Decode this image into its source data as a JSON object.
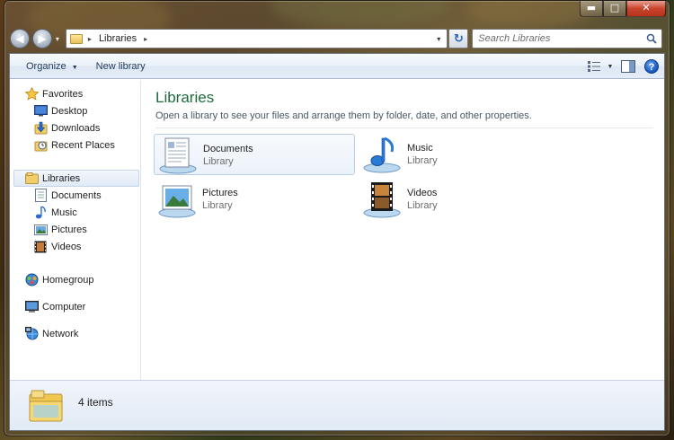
{
  "window": {
    "caption": {
      "minimize": "▬",
      "maximize": "□",
      "close": "✕"
    }
  },
  "navigation": {
    "back_arrow": "◀",
    "forward_arrow": "▶",
    "history_caret": "▾",
    "address": {
      "segments": [
        "Libraries"
      ],
      "separator": "▸",
      "dropdown": "▾"
    },
    "refresh_glyph": "↻",
    "search": {
      "placeholder": "Search Libraries"
    }
  },
  "toolbar": {
    "organize_label": "Organize",
    "organize_caret": "▼",
    "new_library_label": "New library",
    "view_caret": "▼",
    "help_label": "?"
  },
  "sidebar": {
    "favorites": {
      "header": "Favorites",
      "items": [
        {
          "label": "Desktop",
          "icon": "desktop-icon"
        },
        {
          "label": "Downloads",
          "icon": "downloads-icon"
        },
        {
          "label": "Recent Places",
          "icon": "recent-places-icon"
        }
      ]
    },
    "libraries": {
      "header": "Libraries",
      "items": [
        {
          "label": "Documents",
          "icon": "documents-icon"
        },
        {
          "label": "Music",
          "icon": "music-icon"
        },
        {
          "label": "Pictures",
          "icon": "pictures-icon"
        },
        {
          "label": "Videos",
          "icon": "videos-icon"
        }
      ]
    },
    "homegroup": "Homegroup",
    "computer": "Computer",
    "network": "Network"
  },
  "main": {
    "title": "Libraries",
    "subtitle": "Open a library to see your files and arrange them by folder, date, and other properties.",
    "libraries": [
      {
        "name": "Documents",
        "type": "Library",
        "icon": "documents-library-icon",
        "selected": true
      },
      {
        "name": "Music",
        "type": "Library",
        "icon": "music-library-icon",
        "selected": false
      },
      {
        "name": "Pictures",
        "type": "Library",
        "icon": "pictures-library-icon",
        "selected": false
      },
      {
        "name": "Videos",
        "type": "Library",
        "icon": "videos-library-icon",
        "selected": false
      }
    ]
  },
  "status": {
    "item_count": "4 items"
  },
  "colors": {
    "title_green": "#1e6b3a",
    "selection_border": "#b9cde5",
    "toolbar_text": "#1e395b"
  }
}
